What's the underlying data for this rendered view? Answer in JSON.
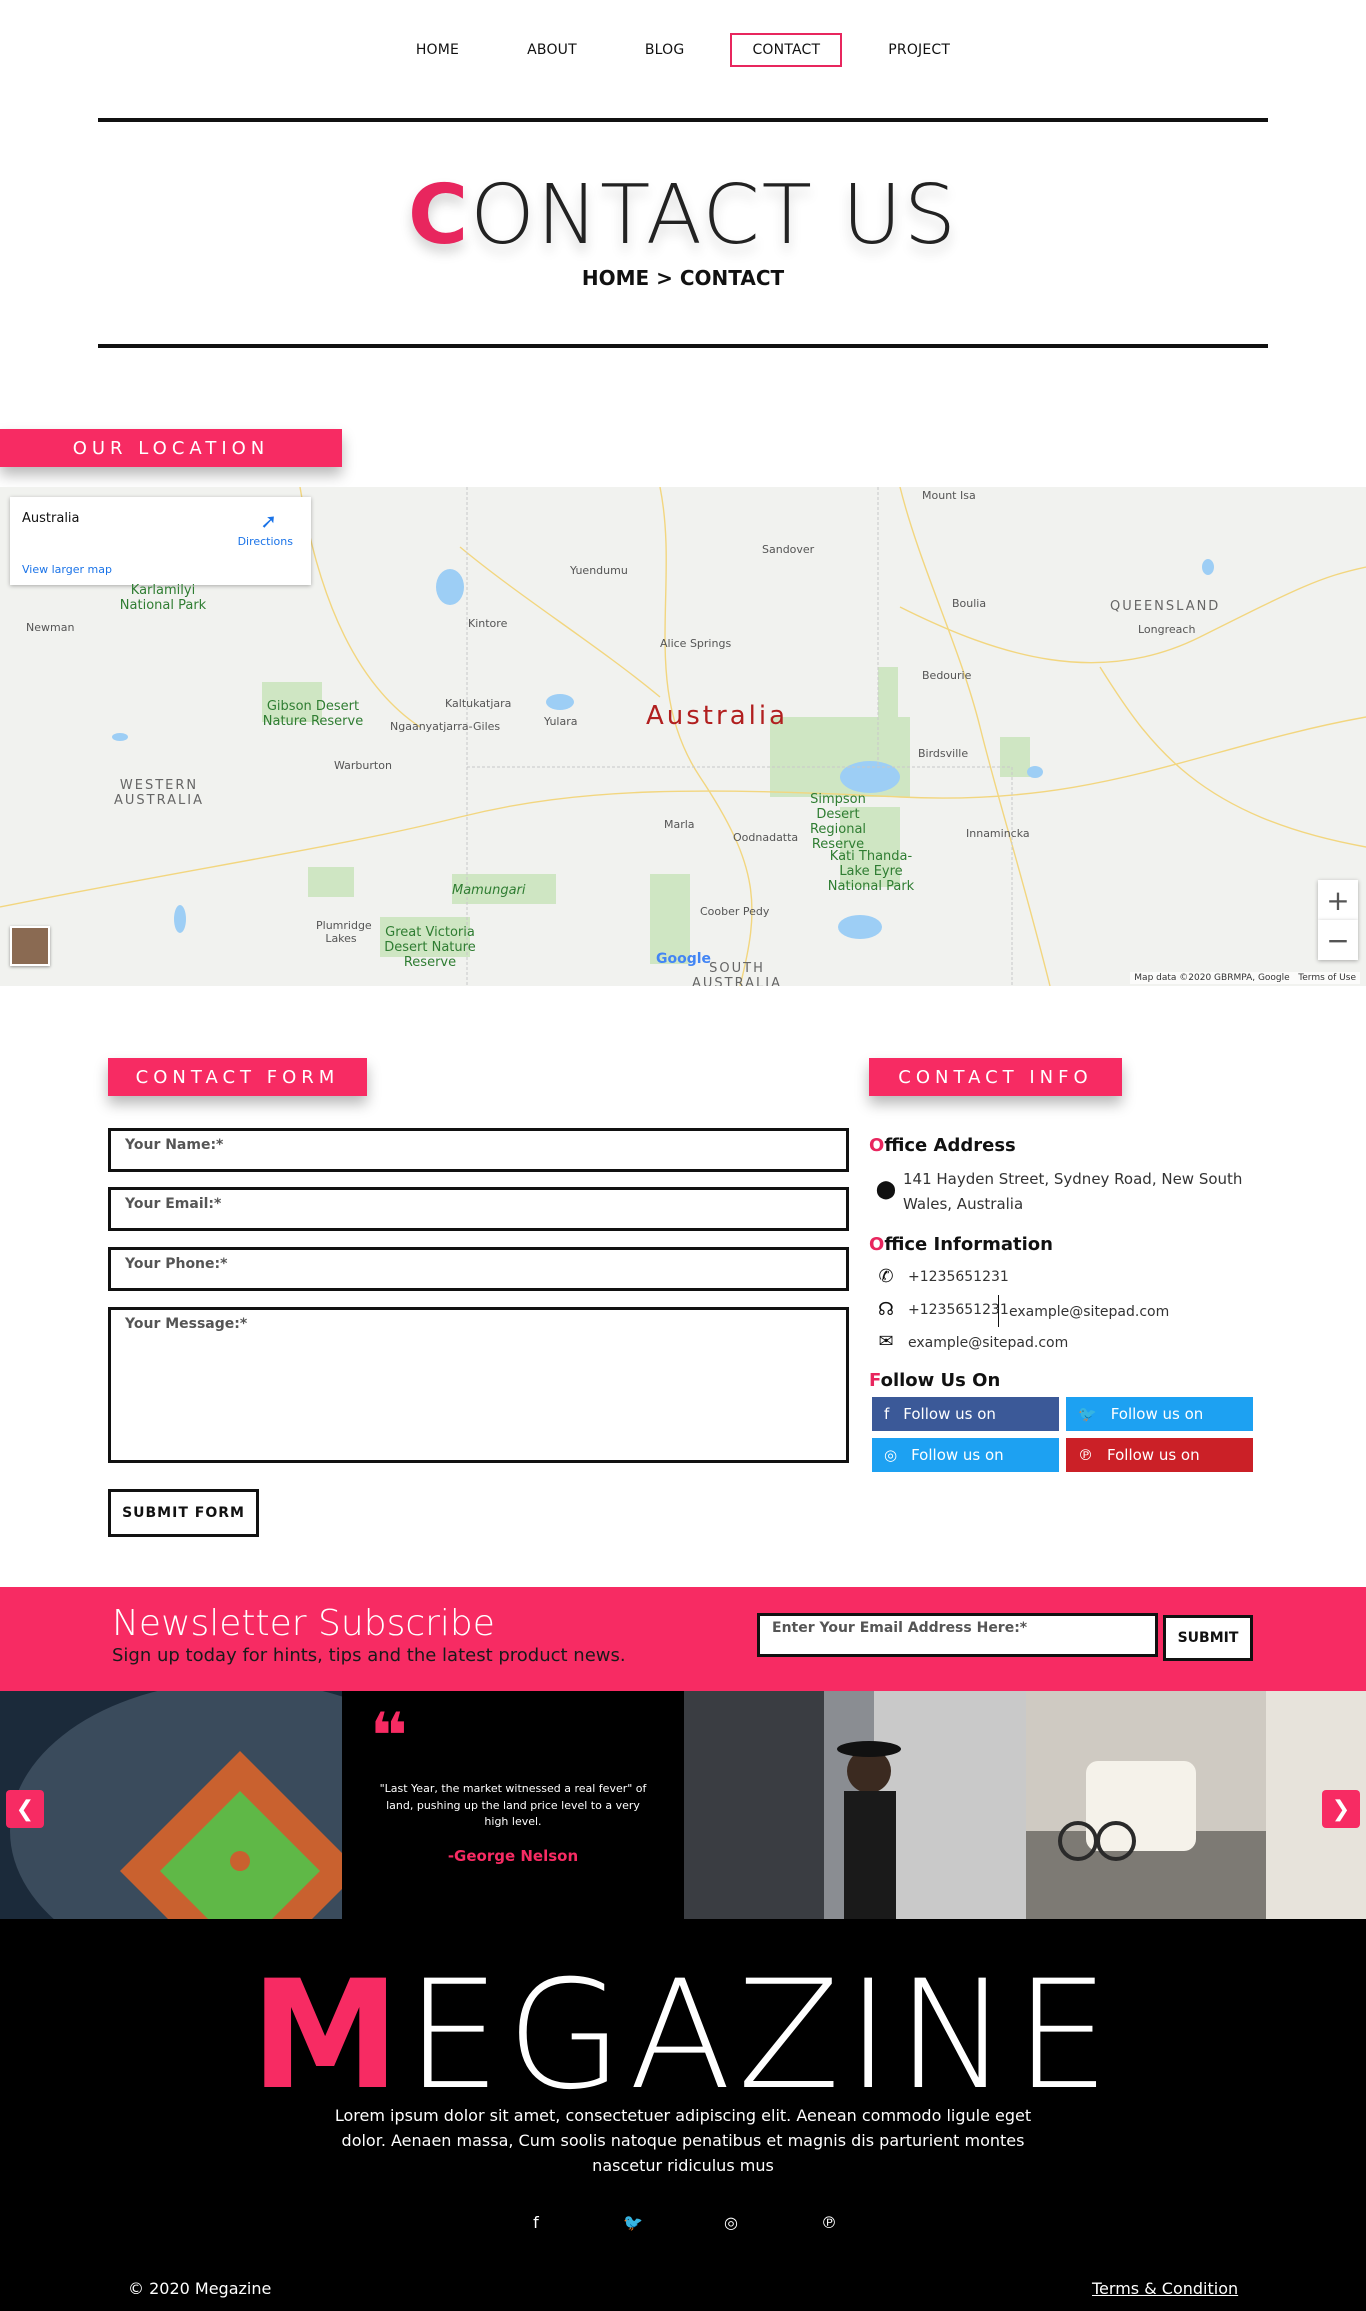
{
  "nav": {
    "items": [
      {
        "label": "HOME"
      },
      {
        "label": "ABOUT"
      },
      {
        "label": "BLOG"
      },
      {
        "label": "CONTACT"
      },
      {
        "label": "PROJECT"
      }
    ],
    "active": "CONTACT"
  },
  "hero": {
    "title_first": "C",
    "title_rest": "ONTACT US",
    "breadcrumb": "HOME > CONTACT"
  },
  "location": {
    "label": "OUR LOCATION",
    "map": {
      "card_title": "Australia",
      "card_link": "View larger map",
      "card_directions": "Directions",
      "main_label": "Australia",
      "regions": [
        "QUEENSLAND",
        "WESTERN AUSTRALIA",
        "SOUTH AUSTRALIA"
      ],
      "places": [
        "Mount Isa",
        "Sandover",
        "Yuendumu",
        "Boulia",
        "Longreach",
        "Kintore",
        "Alice Springs",
        "Bedourie",
        "Kaltukatjara",
        "Ngaanyatjarra-Giles",
        "Yulara",
        "Birdsville",
        "Warburton",
        "Marla",
        "Oodnadatta",
        "Innamincka",
        "Coober Pedy",
        "Plumridge Lakes",
        "Newman"
      ],
      "parks": [
        "Karlamilyi National Park",
        "Gibson Desert Nature Reserve",
        "Simpson Desert Regional Reserve",
        "Kati Thanda-Lake Eyre National Park",
        "Mamungari",
        "Great Victoria Desert Nature Reserve"
      ],
      "attribution": "Map data ©2020 GBRMPA, Google",
      "terms": "Terms of Use",
      "google": "Google"
    }
  },
  "contact_form": {
    "label": "CONTACT FORM",
    "name_placeholder": "Your Name:*",
    "email_placeholder": "Your Email:*",
    "phone_placeholder": "Your Phone:*",
    "message_placeholder": "Your Message:*",
    "submit": "SUBMIT FORM"
  },
  "contact_info": {
    "label": "CONTACT INFO",
    "address_heading_first": "O",
    "address_heading_rest": "ffice Address",
    "address_line1": "141 Hayden Street, Sydney Road, New South",
    "address_line2": "Wales, Australia",
    "info_heading_first": "O",
    "info_heading_rest": "ffice Information",
    "phone1": "+1235651231",
    "phone2": "+1235651231",
    "email_inline": "example@sitepad.com",
    "email": "example@sitepad.com",
    "follow_heading_first": "F",
    "follow_heading_rest": "ollow Us On",
    "socials": [
      {
        "label": "Follow us on",
        "icon": "facebook-icon",
        "color": "#3b5998"
      },
      {
        "label": "Follow us on",
        "icon": "twitter-icon",
        "color": "#1da1f2"
      },
      {
        "label": "Follow us on",
        "icon": "instagram-icon",
        "color": "#1da1f2"
      },
      {
        "label": "Follow us on",
        "icon": "pinterest-icon",
        "color": "#cb2027"
      }
    ]
  },
  "newsletter": {
    "title": "Newsletter Subscribe",
    "subtitle": "Sign up today for hints, tips and the latest product news.",
    "placeholder": "Enter Your Email Address Here:*",
    "submit": "SUBMIT"
  },
  "gallery": {
    "quote": "\"Last Year, the market witnessed a real fever\" of land, pushing up the land price level to a very high level.",
    "author": "-George Nelson",
    "prev": "❮",
    "next": "❯"
  },
  "footer": {
    "logo_first": "M",
    "logo_rest": "EGAZINE",
    "text": "Lorem ipsum dolor sit amet, consectetuer adipiscing elit. Aenean commodo ligule eget dolor. Aenaen massa, Cum soolis natoque penatibus et magnis dis parturient montes nascetur ridiculus mus",
    "copyright": "© 2020 Megazine",
    "terms": "Terms & Condition"
  },
  "colors": {
    "accent": "#f72b63",
    "dark": "#000000"
  }
}
